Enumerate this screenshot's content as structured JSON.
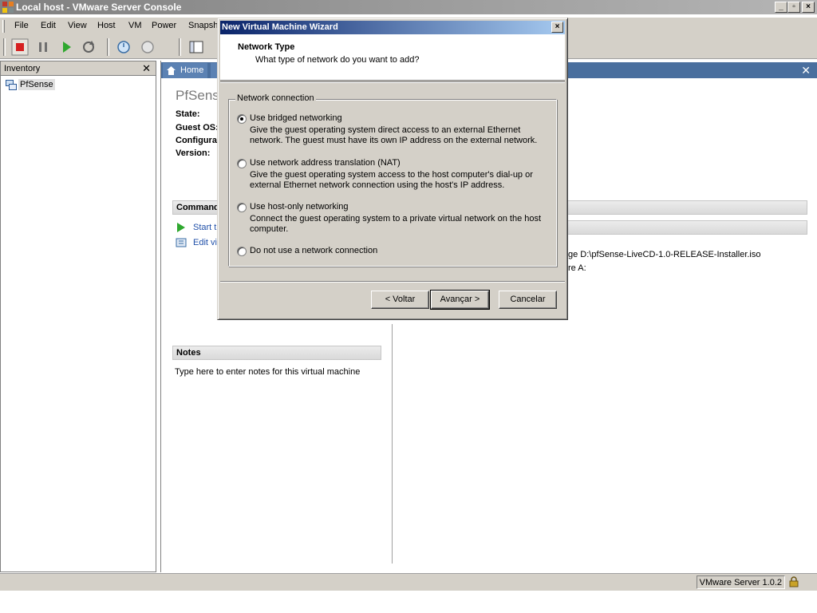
{
  "window": {
    "title": "Local host - VMware Server Console"
  },
  "menubar": {
    "items": [
      "File",
      "Edit",
      "View",
      "Host",
      "VM",
      "Power",
      "Snapsh"
    ]
  },
  "inventory": {
    "title": "Inventory",
    "items": [
      {
        "label": "PfSense"
      }
    ]
  },
  "tabs": [
    {
      "label": "Home"
    }
  ],
  "vm": {
    "title": "PfSens",
    "info_labels": [
      "State:",
      "Guest OS:",
      "Configura",
      "Version:"
    ],
    "commands_header": "Command",
    "commands": [
      "Start t",
      "Edit vi"
    ],
    "notes_header": "Notes",
    "notes_text": "Type here to enter notes for this virtual machine",
    "device_lines": [
      "ge D:\\pfSense-LiveCD-1.0-RELEASE-Installer.iso",
      "re A:"
    ]
  },
  "statusbar": {
    "text": "VMware Server 1.0.2"
  },
  "dialog": {
    "title": "New Virtual Machine Wizard",
    "header_title": "Network Type",
    "header_subtitle": "What type of network do you want to add?",
    "group_label": "Network connection",
    "options": [
      {
        "label": "Use bridged networking",
        "desc": "Give the guest operating system direct access to an external Ethernet network. The guest must have its own IP address on the external network.",
        "checked": true
      },
      {
        "label": "Use network address translation (NAT)",
        "desc": "Give the guest operating system access to the host computer's dial-up or external Ethernet network connection using the host's IP address.",
        "checked": false
      },
      {
        "label": "Use host-only networking",
        "desc": "Connect the guest operating system to a private virtual network on the host computer.",
        "checked": false
      },
      {
        "label": "Do not use a network connection",
        "desc": "",
        "checked": false
      }
    ],
    "buttons": {
      "back": "< Voltar",
      "next": "Avançar >",
      "cancel": "Cancelar"
    }
  }
}
